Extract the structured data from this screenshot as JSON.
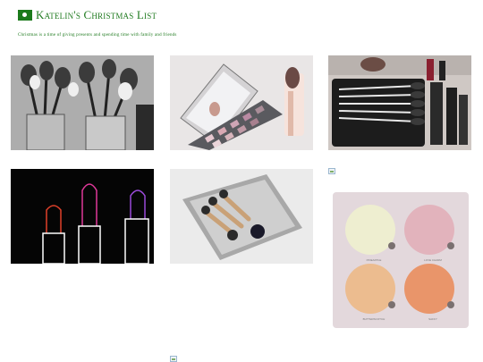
{
  "header": {
    "title": "Katelin's Christmas List",
    "tagline": "Christmas is a time of giving presents and spending time with family and friends"
  },
  "gallery": [
    {
      "name": "makeup-brushes-in-cups-image",
      "subject": "makeup brushes in glass cups"
    },
    {
      "name": "eyeshadow-palette-mirror-image",
      "subject": "eyeshadow palette with mirror"
    },
    {
      "name": "brush-roll-case-image",
      "subject": "brush roll case with brushes"
    },
    {
      "name": "neon-lipsticks-image",
      "subject": "neon lipsticks"
    },
    {
      "name": "brush-set-tray-image",
      "subject": "makeup brushes on a grey tray"
    },
    {
      "name": "highlighter-palette-image",
      "subject": "four-pan highlighter palette",
      "pan_labels": [
        "PINEAPPLE",
        "LOVE CHARM",
        "BUTTERSCOTCH",
        "SAFFY"
      ]
    }
  ],
  "colors": {
    "brand": "#1f7a1f"
  }
}
